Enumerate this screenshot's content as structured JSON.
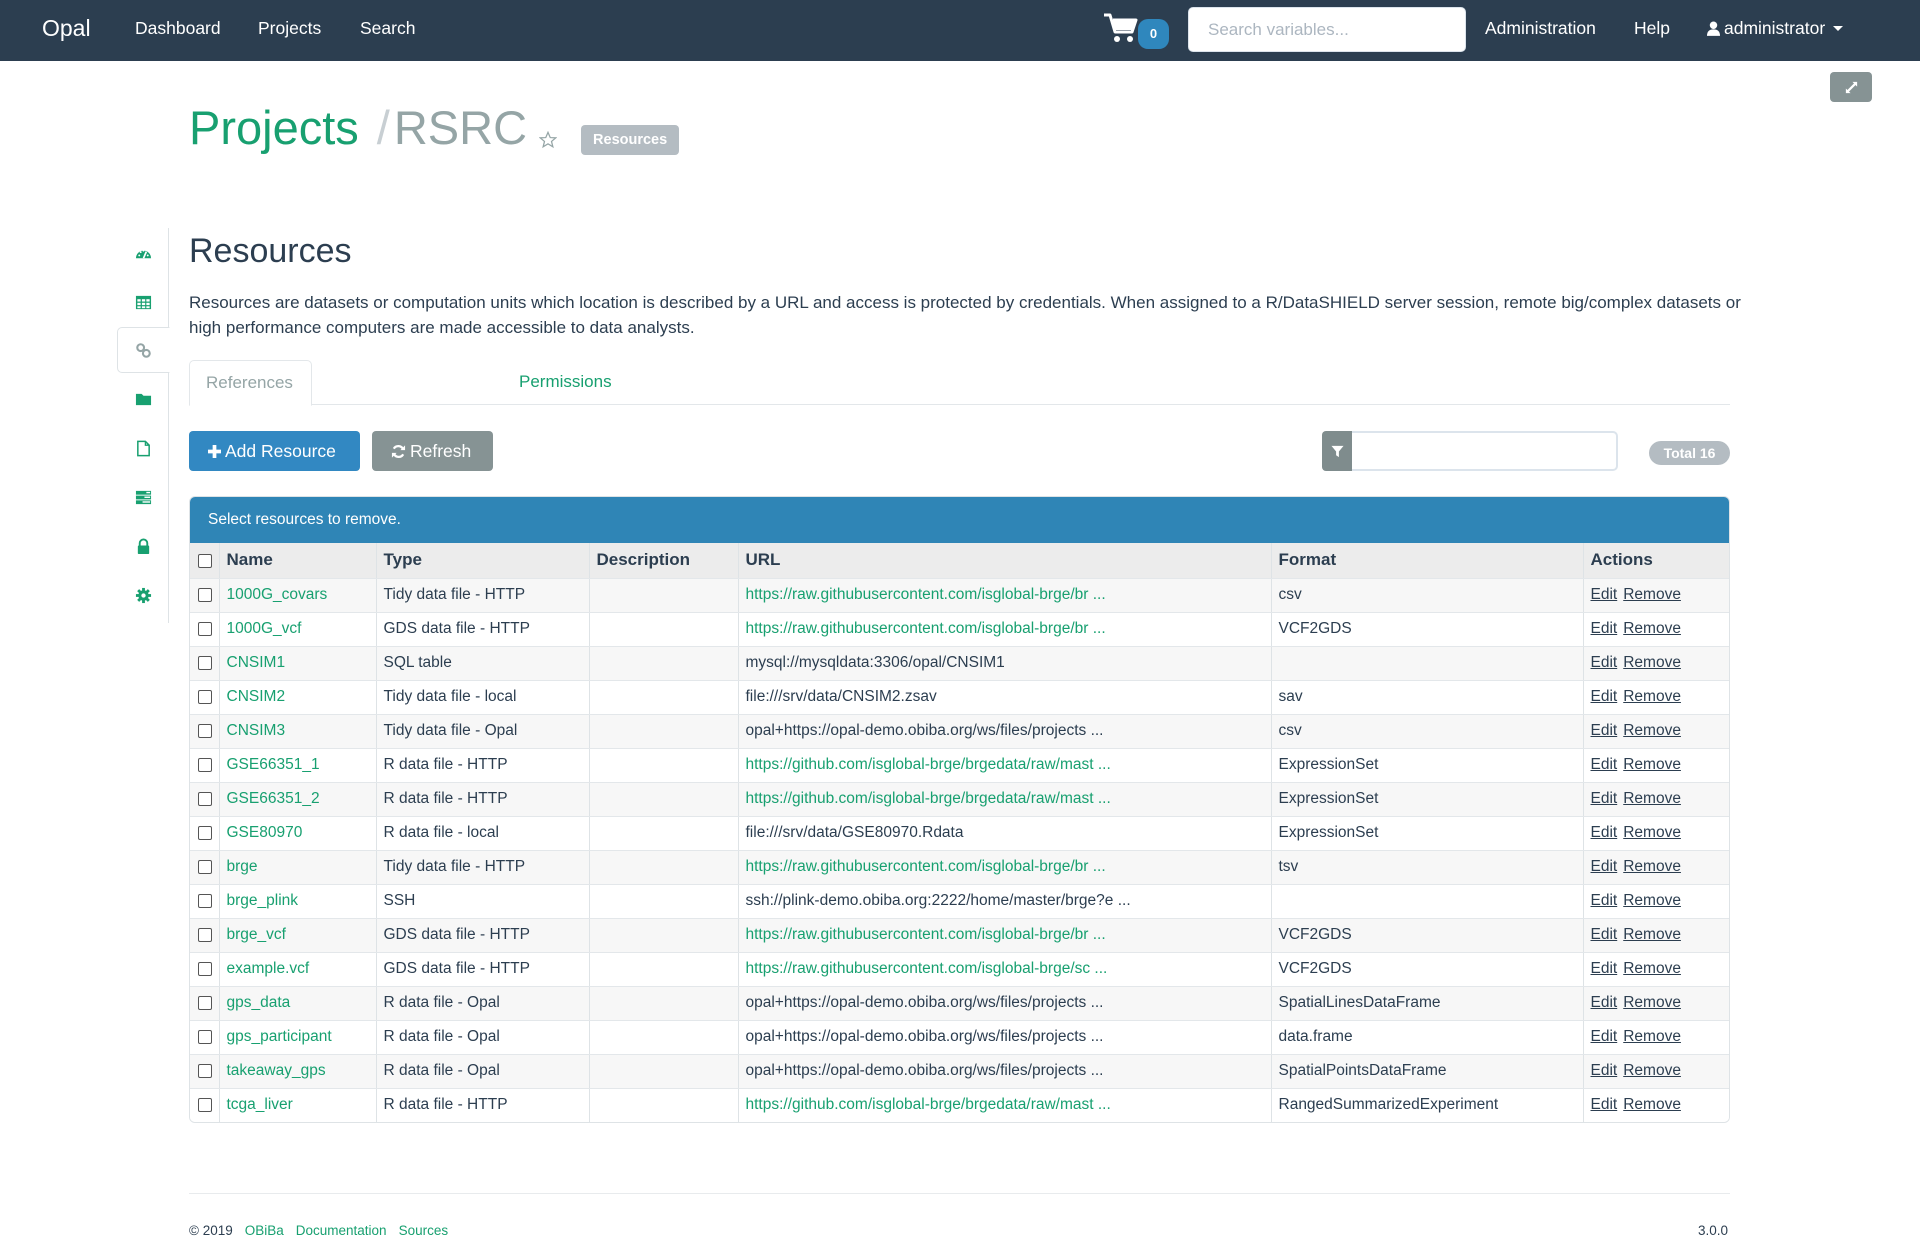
{
  "navbar": {
    "brand": "Opal",
    "links": [
      "Dashboard",
      "Projects",
      "Search"
    ],
    "cart_count": "0",
    "search_placeholder": "Search variables...",
    "administration": "Administration",
    "help": "Help",
    "user": "administrator"
  },
  "header": {
    "projects_label": "Projects",
    "separator": "/",
    "project_name": "RSRC",
    "section_badge": "Resources"
  },
  "sidebar": {
    "items": [
      {
        "icon": "dashboard-icon",
        "label": "Dashboard"
      },
      {
        "icon": "table-icon",
        "label": "Tables"
      },
      {
        "icon": "link-icon",
        "label": "Resources",
        "active": true
      },
      {
        "icon": "folder-icon",
        "label": "Files"
      },
      {
        "icon": "file-icon",
        "label": "Reports"
      },
      {
        "icon": "tasks-icon",
        "label": "Tasks"
      },
      {
        "icon": "lock-icon",
        "label": "Permissions"
      },
      {
        "icon": "gear-icon",
        "label": "Administration"
      }
    ]
  },
  "main": {
    "title": "Resources",
    "description": "Resources are datasets or computation units which location is described by a URL and access is protected by credentials. When assigned to a R/DataSHIELD server session, remote big/complex datasets or high performance computers are made accessible to data analysts.",
    "tabs": [
      {
        "label": "References",
        "active": true
      },
      {
        "label": "Permissions",
        "active": false
      }
    ],
    "add_button": "Add Resource",
    "refresh_button": "Refresh",
    "filter_value": "",
    "total_label": "Total 16",
    "banner": "Select resources to remove.",
    "columns": [
      "Name",
      "Type",
      "Description",
      "URL",
      "Format",
      "Actions"
    ],
    "action_edit": "Edit",
    "action_remove": "Remove",
    "rows": [
      {
        "name": "1000G_covars",
        "type": "Tidy data file - HTTP",
        "description": "",
        "url": "https://raw.githubusercontent.com/isglobal-brge/br ...",
        "url_link": true,
        "format": "csv"
      },
      {
        "name": "1000G_vcf",
        "type": "GDS data file - HTTP",
        "description": "",
        "url": "https://raw.githubusercontent.com/isglobal-brge/br ...",
        "url_link": true,
        "format": "VCF2GDS"
      },
      {
        "name": "CNSIM1",
        "type": "SQL table",
        "description": "",
        "url": "mysql://mysqldata:3306/opal/CNSIM1",
        "url_link": false,
        "format": ""
      },
      {
        "name": "CNSIM2",
        "type": "Tidy data file - local",
        "description": "",
        "url": "file:///srv/data/CNSIM2.zsav",
        "url_link": false,
        "format": "sav"
      },
      {
        "name": "CNSIM3",
        "type": "Tidy data file - Opal",
        "description": "",
        "url": "opal+https://opal-demo.obiba.org/ws/files/projects ...",
        "url_link": false,
        "format": "csv"
      },
      {
        "name": "GSE66351_1",
        "type": "R data file - HTTP",
        "description": "",
        "url": "https://github.com/isglobal-brge/brgedata/raw/mast ...",
        "url_link": true,
        "format": "ExpressionSet"
      },
      {
        "name": "GSE66351_2",
        "type": "R data file - HTTP",
        "description": "",
        "url": "https://github.com/isglobal-brge/brgedata/raw/mast ...",
        "url_link": true,
        "format": "ExpressionSet"
      },
      {
        "name": "GSE80970",
        "type": "R data file - local",
        "description": "",
        "url": "file:///srv/data/GSE80970.Rdata",
        "url_link": false,
        "format": "ExpressionSet"
      },
      {
        "name": "brge",
        "type": "Tidy data file - HTTP",
        "description": "",
        "url": "https://raw.githubusercontent.com/isglobal-brge/br ...",
        "url_link": true,
        "format": "tsv"
      },
      {
        "name": "brge_plink",
        "type": "SSH",
        "description": "",
        "url": "ssh://plink-demo.obiba.org:2222/home/master/brge?e ...",
        "url_link": false,
        "format": ""
      },
      {
        "name": "brge_vcf",
        "type": "GDS data file - HTTP",
        "description": "",
        "url": "https://raw.githubusercontent.com/isglobal-brge/br ...",
        "url_link": true,
        "format": "VCF2GDS"
      },
      {
        "name": "example.vcf",
        "type": "GDS data file - HTTP",
        "description": "",
        "url": "https://raw.githubusercontent.com/isglobal-brge/sc ...",
        "url_link": true,
        "format": "VCF2GDS"
      },
      {
        "name": "gps_data",
        "type": "R data file - Opal",
        "description": "",
        "url": "opal+https://opal-demo.obiba.org/ws/files/projects ...",
        "url_link": false,
        "format": "SpatialLinesDataFrame"
      },
      {
        "name": "gps_participant",
        "type": "R data file - Opal",
        "description": "",
        "url": "opal+https://opal-demo.obiba.org/ws/files/projects ...",
        "url_link": false,
        "format": "data.frame"
      },
      {
        "name": "takeaway_gps",
        "type": "R data file - Opal",
        "description": "",
        "url": "opal+https://opal-demo.obiba.org/ws/files/projects ...",
        "url_link": false,
        "format": "SpatialPointsDataFrame"
      },
      {
        "name": "tcga_liver",
        "type": "R data file - HTTP",
        "description": "",
        "url": "https://github.com/isglobal-brge/brgedata/raw/mast ...",
        "url_link": true,
        "format": "RangedSummarizedExperiment"
      }
    ]
  },
  "footer": {
    "copyright": "© 2019",
    "links": [
      "OBiBa",
      "Documentation",
      "Sources"
    ],
    "version": "3.0.0"
  },
  "colors": {
    "navbar": "#2c3e50",
    "accent_green": "#18a070",
    "primary_blue": "#3288c2",
    "default_gray": "#869394",
    "badge_gray": "#b4bcc2"
  }
}
